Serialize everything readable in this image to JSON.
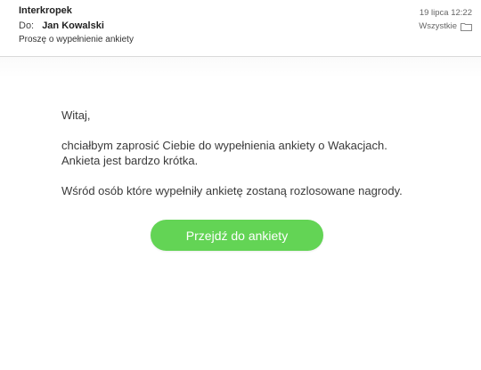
{
  "header": {
    "sender": "Interkropek",
    "to_label": "Do:",
    "to_name": "Jan Kowalski",
    "subject": "Proszę o wypełnienie ankiety",
    "date": "19 lipca 12:22",
    "folder": "Wszystkie",
    "folder_icon": "folder-icon"
  },
  "body": {
    "greeting": "Witaj,",
    "line1": "chciałbym zaprosić Ciebie do wypełnienia ankiety o Wakacjach.",
    "line2": "Ankieta jest bardzo krótka.",
    "line3": "Wśród osób które wypełniły ankietę zostaną rozlosowane nagrody.",
    "cta_label": "Przejdź do ankiety"
  },
  "colors": {
    "cta": "#63d455"
  }
}
